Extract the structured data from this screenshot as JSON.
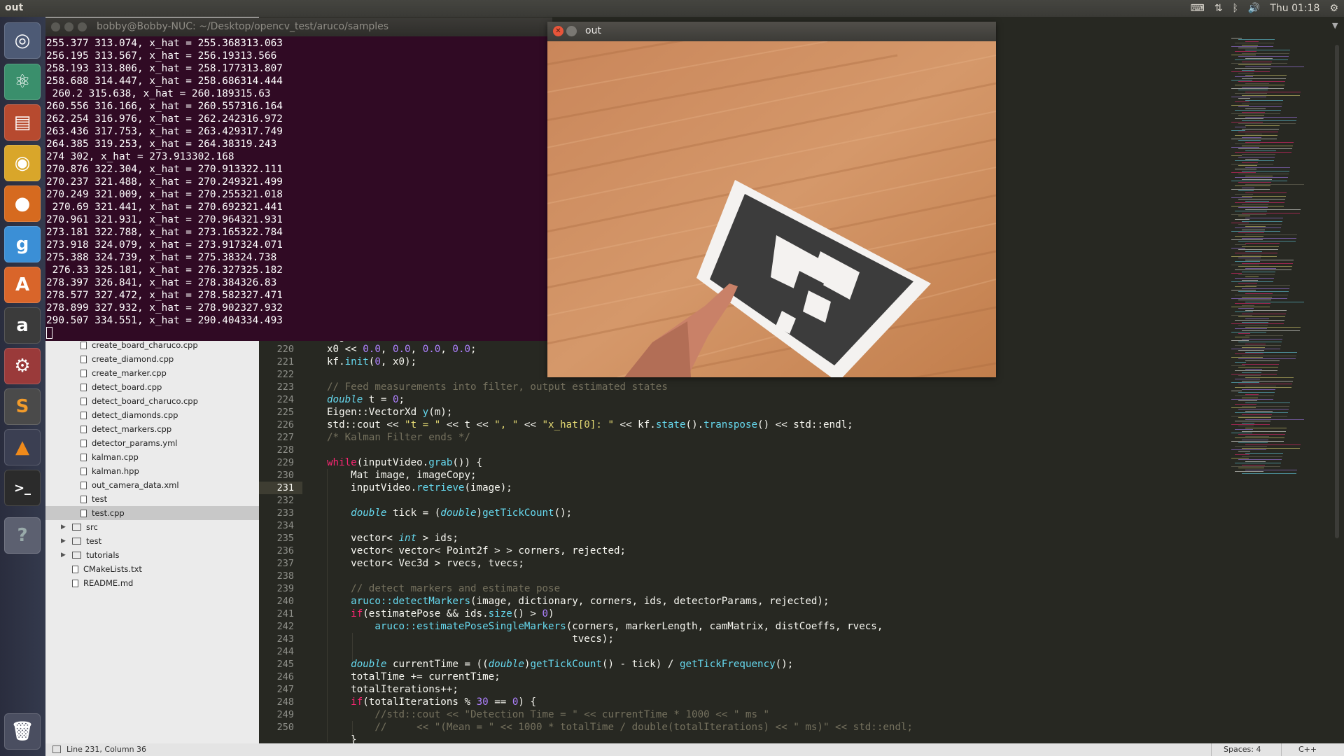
{
  "top_panel": {
    "title": "out",
    "clock": "Thu 01:18"
  },
  "terminal": {
    "title": "bobby@Bobby-NUC: ~/Desktop/opencv_test/aruco/samples",
    "lines": [
      "255.377 313.074, x_hat = 255.368313.063",
      "256.195 313.567, x_hat = 256.19313.566",
      "258.193 313.806, x_hat = 258.177313.807",
      "258.688 314.447, x_hat = 258.686314.444",
      " 260.2 315.638, x_hat = 260.189315.63",
      "260.556 316.166, x_hat = 260.557316.164",
      "262.254 316.976, x_hat = 262.242316.972",
      "263.436 317.753, x_hat = 263.429317.749",
      "264.385 319.253, x_hat = 264.38319.243",
      "274 302, x_hat = 273.913302.168",
      "270.876 322.304, x_hat = 270.913322.111",
      "270.237 321.488, x_hat = 270.249321.499",
      "270.249 321.009, x_hat = 270.255321.018",
      " 270.69 321.441, x_hat = 270.692321.441",
      "270.961 321.931, x_hat = 270.964321.931",
      "273.181 322.788, x_hat = 273.165322.784",
      "273.918 324.079, x_hat = 273.917324.071",
      "275.388 324.739, x_hat = 275.38324.738",
      " 276.33 325.181, x_hat = 276.327325.182",
      "278.397 326.841, x_hat = 278.384326.83",
      "278.577 327.472, x_hat = 278.582327.471",
      "278.899 327.932, x_hat = 278.902327.932",
      "290.507 334.551, x_hat = 290.404334.493"
    ]
  },
  "image_window": {
    "title": "out"
  },
  "sidebar": {
    "files": [
      "create_board_charuco.cpp",
      "create_diamond.cpp",
      "create_marker.cpp",
      "detect_board.cpp",
      "detect_board_charuco.cpp",
      "detect_diamonds.cpp",
      "detect_markers.cpp",
      "detector_params.yml",
      "kalman.cpp",
      "kalman.hpp",
      "out_camera_data.xml",
      "test",
      "test.cpp"
    ],
    "folders": [
      "src",
      "test",
      "tutorials"
    ],
    "root_files": [
      "CMakeLists.txt",
      "README.md"
    ]
  },
  "editor": {
    "line_numbers": [
      "220",
      "221",
      "222",
      "223",
      "224",
      "225",
      "226",
      "227",
      "228",
      "229",
      "230",
      "231",
      "232",
      "233",
      "234",
      "235",
      "236",
      "237",
      "238",
      "239",
      "240",
      "241",
      "242",
      "243",
      "244",
      "245",
      "246",
      "247",
      "248",
      "249",
      "250"
    ],
    "current_line": "231"
  },
  "statusbar": {
    "position": "Line 231, Column 36",
    "spaces": "Spaces: 4",
    "syntax": "C++"
  },
  "colors": {
    "editor_bg": "#272822",
    "terminal_bg": "#300a24",
    "keyword": "#f92672",
    "type": "#66d9ef",
    "number": "#ae81ff",
    "string": "#e6db74",
    "comment": "#75715e"
  }
}
